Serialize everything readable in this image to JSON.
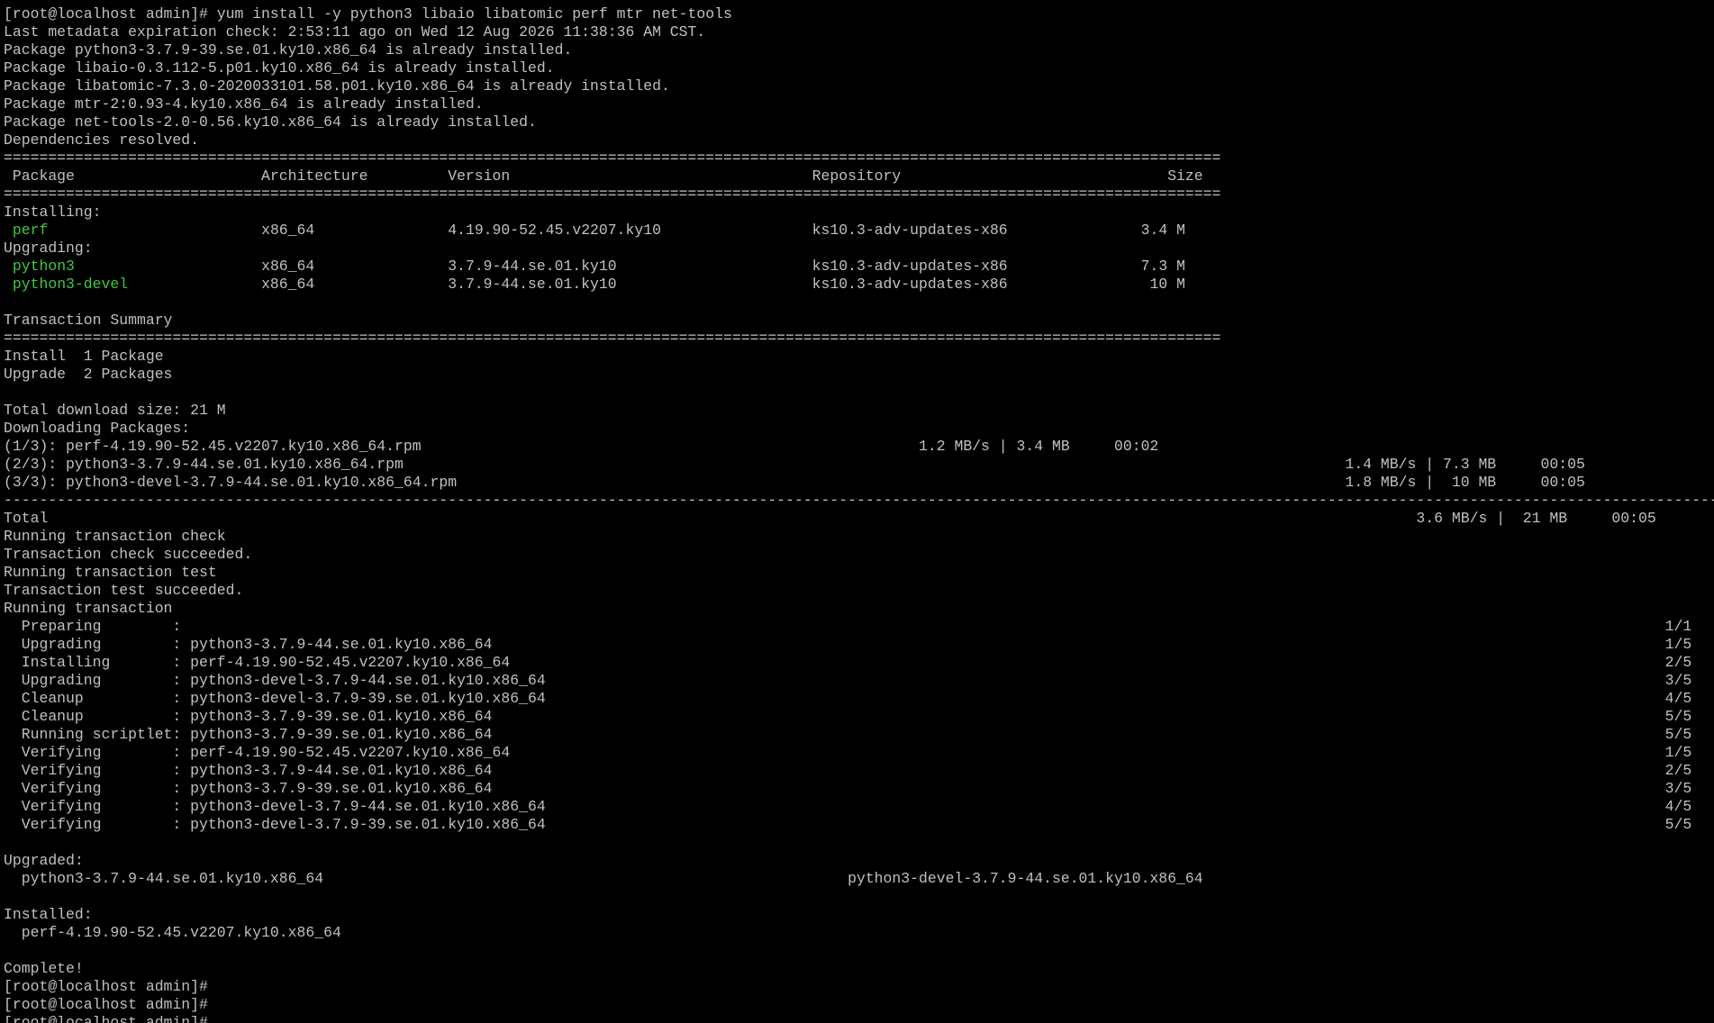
{
  "terminal": {
    "colors": {
      "background": "#000000",
      "text": "#c0c0c0",
      "package_name": "#3fc83f"
    },
    "lines": [
      [
        {
          "t": "[root@localhost admin]# yum install -y python3 libaio libatomic perf mtr net-tools"
        }
      ],
      [
        {
          "t": "Last metadata expiration check: 2:53:11 ago on Wed 12 Aug 2026 11:38:36 AM CST."
        }
      ],
      [
        {
          "t": "Package python3-3.7.9-39.se.01.ky10.x86_64 is already installed."
        }
      ],
      [
        {
          "t": "Package libaio-0.3.112-5.p01.ky10.x86_64 is already installed."
        }
      ],
      [
        {
          "t": "Package libatomic-7.3.0-2020033101.58.p01.ky10.x86_64 is already installed."
        }
      ],
      [
        {
          "t": "Package mtr-2:0.93-4.ky10.x86_64 is already installed."
        }
      ],
      [
        {
          "t": "Package net-tools-2.0-0.56.ky10.x86_64 is already installed."
        }
      ],
      [
        {
          "t": "Dependencies resolved."
        }
      ],
      [
        {
          "t": "========================================================================================================================================="
        }
      ],
      [
        {
          "t": " Package                     Architecture         Version                                  Repository                              Size"
        }
      ],
      [
        {
          "t": "========================================================================================================================================="
        }
      ],
      [
        {
          "t": "Installing:"
        }
      ],
      [
        {
          "t": " "
        },
        {
          "t": "perf",
          "c": "pkg"
        },
        {
          "t": "                        x86_64               4.19.90-52.45.v2207.ky10                 ks10.3-adv-updates-x86               3.4 M"
        }
      ],
      [
        {
          "t": "Upgrading:"
        }
      ],
      [
        {
          "t": " "
        },
        {
          "t": "python3",
          "c": "pkg"
        },
        {
          "t": "                     x86_64               3.7.9-44.se.01.ky10                      ks10.3-adv-updates-x86               7.3 M"
        }
      ],
      [
        {
          "t": " "
        },
        {
          "t": "python3-devel",
          "c": "pkg"
        },
        {
          "t": "               x86_64               3.7.9-44.se.01.ky10                      ks10.3-adv-updates-x86                10 M"
        }
      ],
      [
        {
          "t": ""
        }
      ],
      [
        {
          "t": "Transaction Summary"
        }
      ],
      [
        {
          "t": "========================================================================================================================================="
        }
      ],
      [
        {
          "t": "Install  1 Package"
        }
      ],
      [
        {
          "t": "Upgrade  2 Packages"
        }
      ],
      [
        {
          "t": ""
        }
      ],
      [
        {
          "t": "Total download size: 21 M"
        }
      ],
      [
        {
          "t": "Downloading Packages:"
        }
      ],
      [
        {
          "t": "(1/3): perf-4.19.90-52.45.v2207.ky10.x86_64.rpm                                                        1.2 MB/s | 3.4 MB     00:02"
        }
      ],
      [
        {
          "t": "(2/3): python3-3.7.9-44.se.01.ky10.x86_64.rpm                                                                                                          1.4 MB/s | 7.3 MB     00:05"
        }
      ],
      [
        {
          "t": "(3/3): python3-devel-3.7.9-44.se.01.ky10.x86_64.rpm                                                                                                    1.8 MB/s |  10 MB     00:05"
        }
      ],
      [
        {
          "t": "---------------------------------------------------------------------------------------------------------------------------------------------------------------------------------------------------------"
        }
      ],
      [
        {
          "t": "Total                                                                                                                                                          3.6 MB/s |  21 MB     00:05"
        }
      ],
      [
        {
          "t": "Running transaction check"
        }
      ],
      [
        {
          "t": "Transaction check succeeded."
        }
      ],
      [
        {
          "t": "Running transaction test"
        }
      ],
      [
        {
          "t": "Transaction test succeeded."
        }
      ],
      [
        {
          "t": "Running transaction"
        }
      ],
      [
        {
          "t": "  Preparing        :                                                                                                                                                                       1/1"
        }
      ],
      [
        {
          "t": "  Upgrading        : python3-3.7.9-44.se.01.ky10.x86_64                                                                                                                                    1/5"
        }
      ],
      [
        {
          "t": "  Installing       : perf-4.19.90-52.45.v2207.ky10.x86_64                                                                                                                                  2/5"
        }
      ],
      [
        {
          "t": "  Upgrading        : python3-devel-3.7.9-44.se.01.ky10.x86_64                                                                                                                              3/5"
        }
      ],
      [
        {
          "t": "  Cleanup          : python3-devel-3.7.9-39.se.01.ky10.x86_64                                                                                                                              4/5"
        }
      ],
      [
        {
          "t": "  Cleanup          : python3-3.7.9-39.se.01.ky10.x86_64                                                                                                                                    5/5"
        }
      ],
      [
        {
          "t": "  Running scriptlet: python3-3.7.9-39.se.01.ky10.x86_64                                                                                                                                    5/5"
        }
      ],
      [
        {
          "t": "  Verifying        : perf-4.19.90-52.45.v2207.ky10.x86_64                                                                                                                                  1/5"
        }
      ],
      [
        {
          "t": "  Verifying        : python3-3.7.9-44.se.01.ky10.x86_64                                                                                                                                    2/5"
        }
      ],
      [
        {
          "t": "  Verifying        : python3-3.7.9-39.se.01.ky10.x86_64                                                                                                                                    3/5"
        }
      ],
      [
        {
          "t": "  Verifying        : python3-devel-3.7.9-44.se.01.ky10.x86_64                                                                                                                              4/5"
        }
      ],
      [
        {
          "t": "  Verifying        : python3-devel-3.7.9-39.se.01.ky10.x86_64                                                                                                                              5/5"
        }
      ],
      [
        {
          "t": ""
        }
      ],
      [
        {
          "t": "Upgraded:"
        }
      ],
      [
        {
          "t": "  python3-3.7.9-44.se.01.ky10.x86_64                                                           python3-devel-3.7.9-44.se.01.ky10.x86_64"
        }
      ],
      [
        {
          "t": ""
        }
      ],
      [
        {
          "t": "Installed:"
        }
      ],
      [
        {
          "t": "  perf-4.19.90-52.45.v2207.ky10.x86_64"
        }
      ],
      [
        {
          "t": ""
        }
      ],
      [
        {
          "t": "Complete!"
        }
      ],
      [
        {
          "t": "[root@localhost admin]#"
        }
      ],
      [
        {
          "t": "[root@localhost admin]#"
        }
      ],
      [
        {
          "t": "[root@localhost admin]#"
        }
      ]
    ]
  }
}
